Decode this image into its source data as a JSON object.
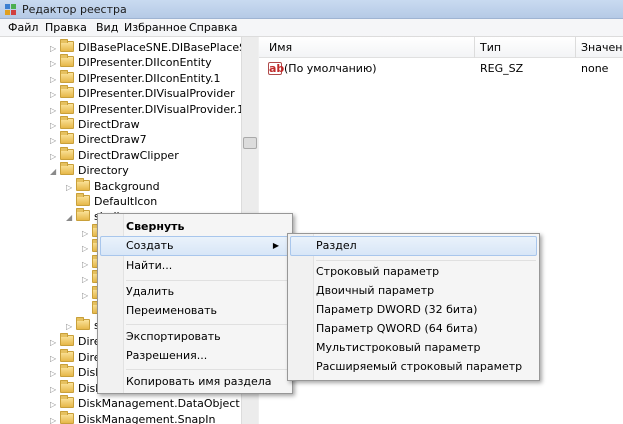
{
  "window": {
    "title": "Редактор реестра"
  },
  "menubar": [
    "Файл",
    "Правка",
    "Вид",
    "Избранное",
    "Справка"
  ],
  "tree": {
    "rows": [
      {
        "label": "DIBasePlaceSNE.DIBasePlaceSNEImp",
        "arrow": "▷"
      },
      {
        "label": "DIPresenter.DIIconEntity",
        "arrow": "▷"
      },
      {
        "label": "DIPresenter.DIIconEntity.1",
        "arrow": "▷"
      },
      {
        "label": "DIPresenter.DIVisualProvider",
        "arrow": "▷"
      },
      {
        "label": "DIPresenter.DIVisualProvider.1",
        "arrow": "▷"
      },
      {
        "label": "DirectDraw",
        "arrow": "▷"
      },
      {
        "label": "DirectDraw7",
        "arrow": "▷"
      },
      {
        "label": "DirectDrawClipper",
        "arrow": "▷"
      },
      {
        "label": "Directory",
        "arrow": "◢"
      },
      {
        "label": "Background",
        "arrow": "▷"
      },
      {
        "label": "DefaultIcon",
        "arrow": ""
      },
      {
        "label": "shell",
        "arrow": "◢"
      },
      {
        "label": "",
        "arrow": "▷"
      },
      {
        "label": "",
        "arrow": "▷"
      },
      {
        "label": "",
        "arrow": "▷"
      },
      {
        "label": "",
        "arrow": "▷"
      },
      {
        "label": "",
        "arrow": "▷"
      },
      {
        "label": "",
        "arrow": ""
      },
      {
        "label": "s",
        "arrow": "▷"
      },
      {
        "label": "Dire",
        "arrow": "▷"
      },
      {
        "label": "Dire",
        "arrow": "▷"
      },
      {
        "label": "Disk",
        "arrow": "▷"
      },
      {
        "label": "Disk",
        "arrow": "▷"
      },
      {
        "label": "DiskManagement.DataObject",
        "arrow": "▷"
      },
      {
        "label": "DiskManagement.SnapIn",
        "arrow": "▷"
      }
    ]
  },
  "values": {
    "columns": [
      "Имя",
      "Тип",
      "Значение"
    ],
    "rows": [
      {
        "name": "(По умолчанию)",
        "type": "REG_SZ",
        "value": "none"
      }
    ]
  },
  "context_menu": {
    "items": [
      "Свернуть",
      "Создать",
      "Найти...",
      "Удалить",
      "Переименовать",
      "Экспортировать",
      "Разрешения...",
      "Копировать имя раздела"
    ],
    "submenu_arrow": "▶"
  },
  "submenu": {
    "items": [
      "Раздел",
      "Строковый параметр",
      "Двоичный параметр",
      "Параметр DWORD (32 бита)",
      "Параметр QWORD (64 бита)",
      "Мультистроковый параметр",
      "Расширяемый строковый параметр"
    ]
  }
}
